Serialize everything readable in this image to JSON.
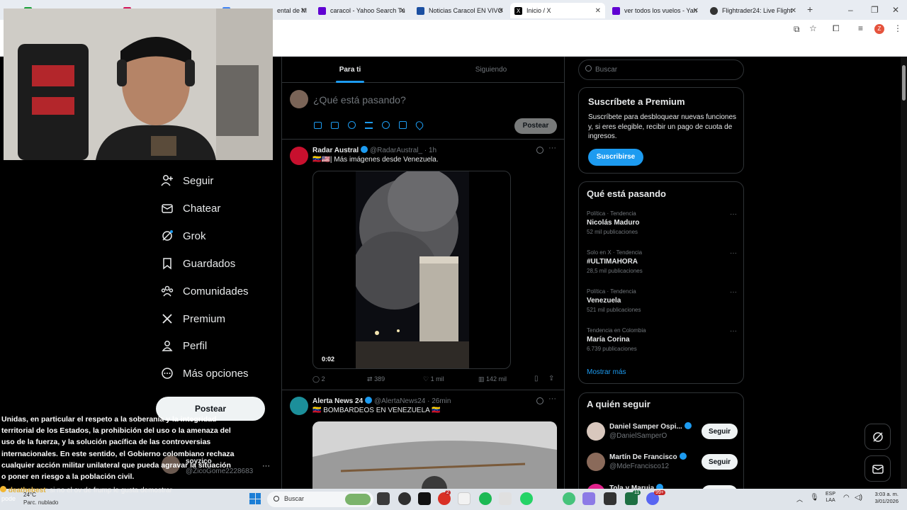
{
  "browser": {
    "tabs": [
      {
        "label": "",
        "color": "#19a038"
      },
      {
        "label": "",
        "color": "#d4145a"
      },
      {
        "label": "ental de M",
        "color": "#4285f4"
      },
      {
        "label": "caracol - Yahoo Search Tu",
        "color": "#6001d2"
      },
      {
        "label": "Noticias Caracol EN VIVO",
        "color": "#1b4fa1"
      },
      {
        "label": "Inicio / X",
        "color": "#000000",
        "active": true
      },
      {
        "label": "ver todos los vuelos - Yah",
        "color": "#6001d2"
      },
      {
        "label": "Flightrader24: Live Flight",
        "color": "#333333"
      }
    ],
    "new_tab": "+",
    "window_controls": [
      "–",
      "❐",
      "✕"
    ],
    "profile_initial": "Z"
  },
  "left_nav": {
    "items": [
      {
        "label": "Seguir",
        "icon": "person-add-icon"
      },
      {
        "label": "Chatear",
        "icon": "mail-icon"
      },
      {
        "label": "Grok",
        "icon": "grok-icon"
      },
      {
        "label": "Guardados",
        "icon": "bookmark-icon"
      },
      {
        "label": "Comunidades",
        "icon": "communities-icon"
      },
      {
        "label": "Premium",
        "icon": "x-logo-icon"
      },
      {
        "label": "Perfil",
        "icon": "person-icon"
      },
      {
        "label": "Más opciones",
        "icon": "more-circle-icon"
      }
    ],
    "post_button": "Postear",
    "account": {
      "name": "soyzico",
      "handle": "@ZicoGome2228683"
    },
    "more": "···"
  },
  "overlay": {
    "paragraph": "Unidas, en particular el respeto a la soberanía y la integridad territorial de los Estados, la prohibición del uso o la amenaza del uso de la fuerza, y la solución pacífica de las controversias internacionales. En este sentido, el Gobierno colombiano rechaza cualquier acción militar unilateral que pueda agravar la situación o poner en riesgo a la población civil.",
    "chat_user": "deathebest",
    "chat_text": ": si no el ov de frump le gusta demostrar",
    "chat_tail": "pode"
  },
  "timeline": {
    "tabs": [
      "Para ti",
      "Siguiendo"
    ],
    "compose_placeholder": "¿Qué está pasando?",
    "compose_button": "Postear",
    "posts": [
      {
        "name": "Radar Austral",
        "handle": "@RadarAustral_",
        "time": "· 1h",
        "text": "🇻🇪🇺🇸| Más imágenes desde Venezuela.",
        "video_time": "0:02",
        "replies": "2",
        "reposts": "389",
        "likes": "1 mil",
        "views": "142 mil"
      },
      {
        "name": "Alerta News 24",
        "handle": "@AlertaNews24",
        "time": "· 26min",
        "text": "🇻🇪 BOMBARDEOS EN VENEZUELA 🇻🇪"
      }
    ]
  },
  "sidebar": {
    "search_placeholder": "Buscar",
    "premium": {
      "title": "Suscríbete a Premium",
      "body": "Suscríbete para desbloquear nuevas funciones y, si eres elegible, recibir un pago de cuota de ingresos.",
      "button": "Suscribirse"
    },
    "trends_title": "Qué está pasando",
    "trends": [
      {
        "meta": "Política · Tendencia",
        "title": "Nicolás Maduro",
        "count": "52 mil publicaciones"
      },
      {
        "meta": "Solo en X · Tendencia",
        "title": "#ULTIMAHORA",
        "count": "28,5 mil publicaciones"
      },
      {
        "meta": "Política · Tendencia",
        "title": "Venezuela",
        "count": "521 mil publicaciones"
      },
      {
        "meta": "Tendencia en Colombia",
        "title": "María Corina",
        "count": "6.739 publicaciones"
      }
    ],
    "show_more": "Mostrar más",
    "who_title": "A quién seguir",
    "who": [
      {
        "name": "Daniel Samper Ospi...",
        "handle": "@DanielSamperO",
        "button": "Seguir"
      },
      {
        "name": "Martín De Francisco",
        "handle": "@MdeFrancisco12",
        "button": "Seguir"
      },
      {
        "name": "Tola y Maruja",
        "handle": "",
        "button": ""
      }
    ]
  },
  "taskbar": {
    "weather_temp": "24°C",
    "weather_desc": "Parc. nublado",
    "search": "Buscar",
    "lang": "ESP",
    "lang2": "LAA",
    "time": "3:03 a. m.",
    "date": "3/01/2026",
    "badge1": "2",
    "badge2": "11",
    "badge3": "99+"
  },
  "colors": {
    "accent": "#1d9bf0",
    "bg": "#000000",
    "border": "#2f3336",
    "muted": "#71767b"
  }
}
